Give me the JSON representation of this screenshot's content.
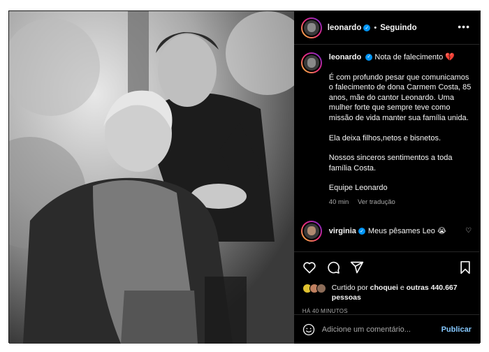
{
  "header": {
    "username": "leonardo",
    "separator": "•",
    "follow_status": "Seguindo",
    "more_icon": "more-horizontal-icon"
  },
  "post": {
    "caption_user": "leonardo",
    "caption_title": "Nota de falecimento",
    "caption_emoji": "💔",
    "paragraphs": [
      "É com profundo pesar que comunicamos o falecimento de dona Carmem Costa, 85 anos, mãe do cantor Leonardo. Uma mulher forte que sempre teve como missão de vida manter sua família unida.",
      "Ela deixa filhos,netos e bisnetos.",
      "Nossos sinceros sentimentos a toda família Costa.",
      "Equipe Leonardo"
    ],
    "time_ago": "40 min",
    "translate": "Ver tradução"
  },
  "comments": [
    {
      "user": "virginia",
      "text": "Meus pêsames Leo 😭"
    }
  ],
  "actions": {
    "like_icon": "heart-icon",
    "comment_icon": "comment-icon",
    "share_icon": "send-icon",
    "save_icon": "bookmark-icon"
  },
  "likes": {
    "prefix": "Curtido por",
    "first_liker": "choquei",
    "connector": "e",
    "others": "outras 440.667 pessoas"
  },
  "timestamp": "HÁ 40 MINUTOS",
  "add_comment": {
    "placeholder": "Adicione um comentário...",
    "publish": "Publicar"
  },
  "colors": {
    "verified": "#0095f6",
    "publish": "#85c8ff",
    "background": "#000000",
    "muted_text": "#a8a8a8"
  }
}
